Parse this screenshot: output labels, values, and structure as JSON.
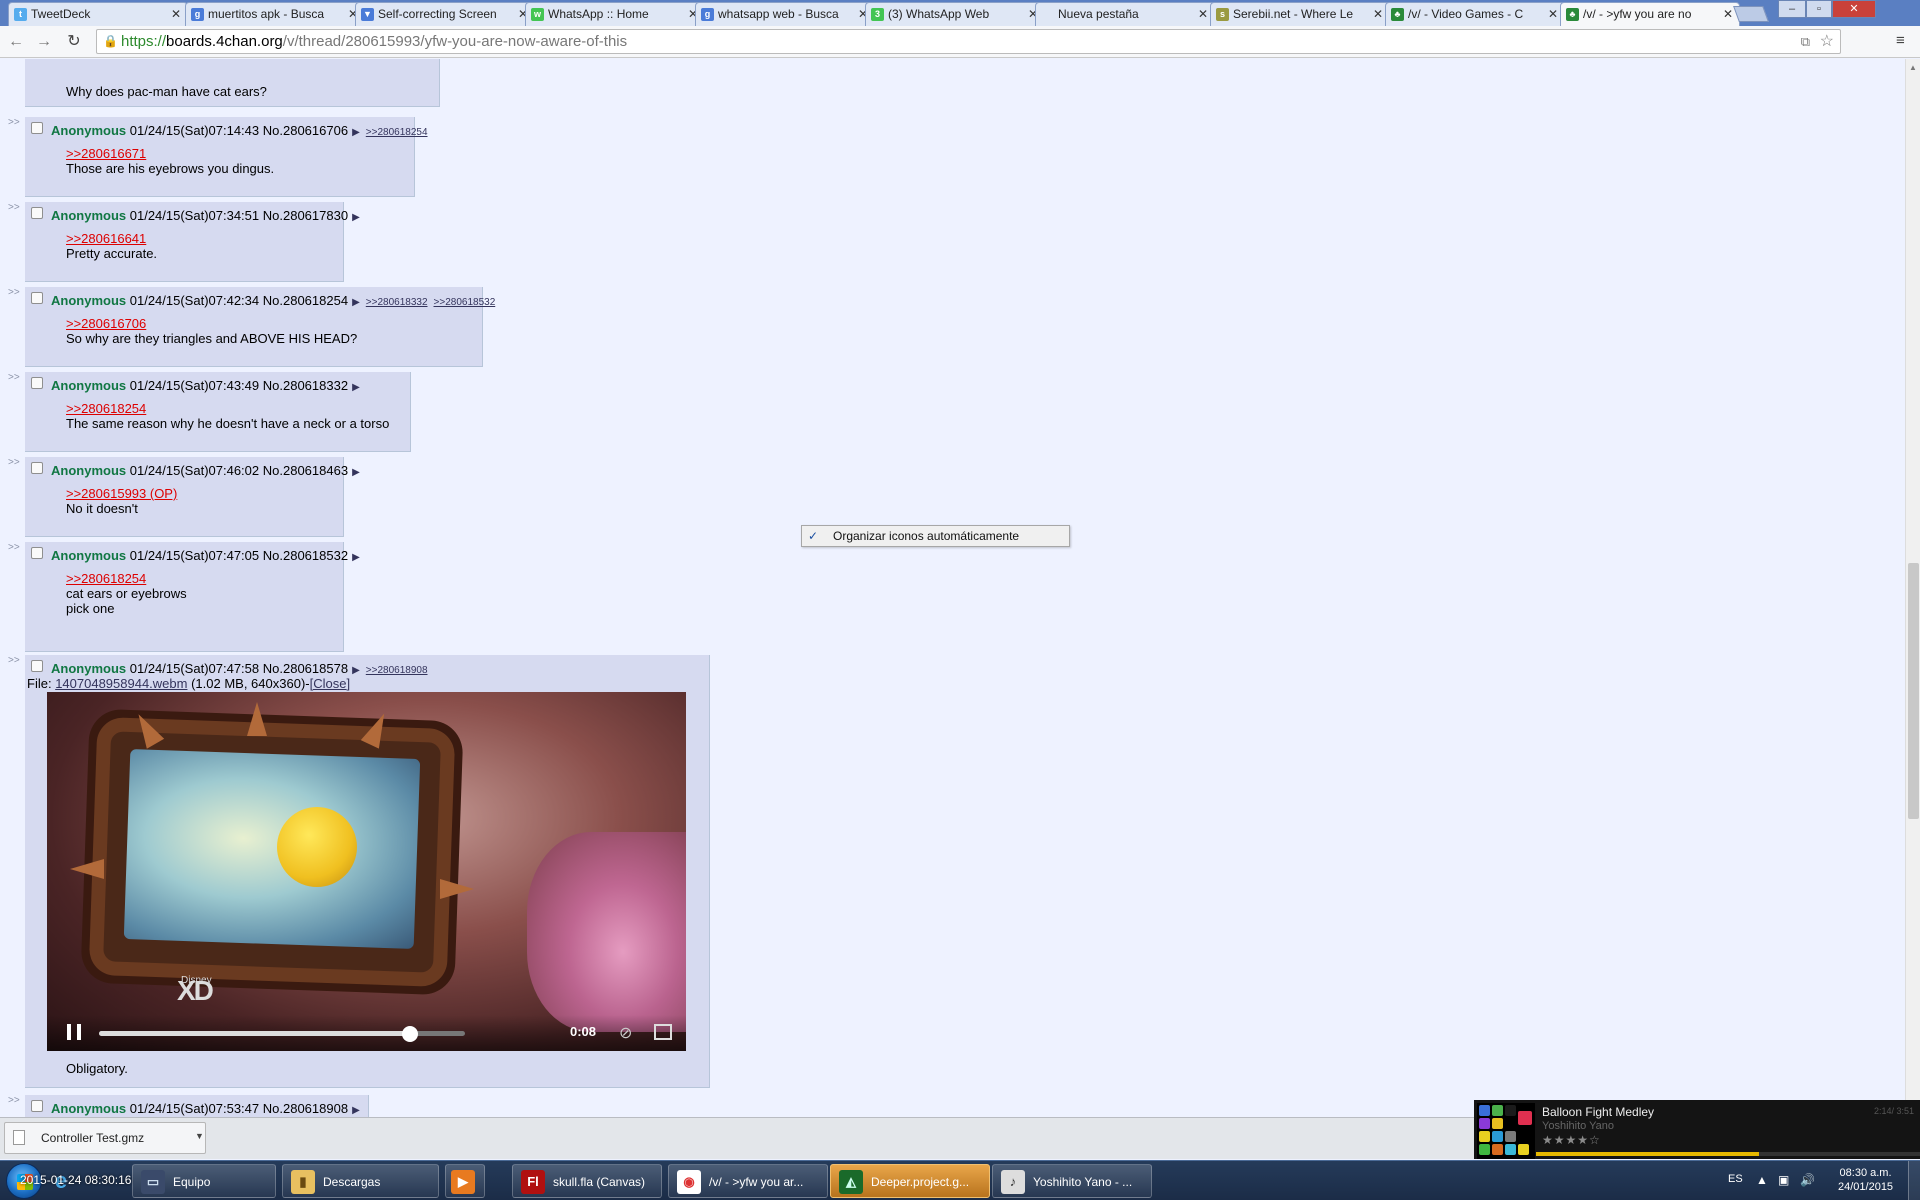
{
  "browser": {
    "tabs": [
      {
        "title": "TweetDeck",
        "favicon": "twitter-icon",
        "color": "#55acee",
        "glyph": "t"
      },
      {
        "title": "muertitos apk - Busca",
        "favicon": "google-icon",
        "color": "#4a7bd8",
        "glyph": "g"
      },
      {
        "title": "Self-correcting Screen",
        "favicon": "bookmark-icon",
        "color": "#4a7bd8",
        "glyph": "▼"
      },
      {
        "title": "WhatsApp :: Home",
        "favicon": "whatsapp-icon",
        "color": "#43c553",
        "glyph": "w"
      },
      {
        "title": "whatsapp web - Busca",
        "favicon": "google-icon",
        "color": "#4a7bd8",
        "glyph": "g"
      },
      {
        "title": "(3) WhatsApp Web",
        "favicon": "whatsapp-icon",
        "color": "#43c553",
        "glyph": "3"
      },
      {
        "title": "Nueva pestaña",
        "favicon": "",
        "color": "transparent",
        "glyph": ""
      },
      {
        "title": "Serebii.net - Where Le",
        "favicon": "serebii-icon",
        "color": "#9a9a40",
        "glyph": "s"
      },
      {
        "title": "/v/ - Video Games - C",
        "favicon": "clover-icon",
        "color": "#2a8a3a",
        "glyph": "♣"
      },
      {
        "title": "/v/ - >yfw you are no",
        "favicon": "clover-icon",
        "color": "#2a8a3a",
        "glyph": "♣",
        "active": true
      }
    ],
    "url": {
      "scheme": "https://",
      "host": "boards.4chan.org",
      "path": "/v/thread/280615993/yfw-you-are-now-aware-of-this"
    }
  },
  "thread": {
    "partial_top_message": "Why does pac-man have cat ears?",
    "posts": [
      {
        "name": "Anonymous",
        "datetime": "01/24/15(Sat)07:14:43",
        "number": "No.280616706",
        "backlinks": [
          ">>280618254"
        ],
        "quote": ">>280616671",
        "lines": [
          "Those are his eyebrows you dingus."
        ]
      },
      {
        "name": "Anonymous",
        "datetime": "01/24/15(Sat)07:34:51",
        "number": "No.280617830",
        "backlinks": [],
        "quote": ">>280616641",
        "lines": [
          "Pretty accurate."
        ]
      },
      {
        "name": "Anonymous",
        "datetime": "01/24/15(Sat)07:42:34",
        "number": "No.280618254",
        "backlinks": [
          ">>280618332",
          ">>280618532"
        ],
        "quote": ">>280616706",
        "lines": [
          "So why are they triangles and ABOVE HIS HEAD?"
        ]
      },
      {
        "name": "Anonymous",
        "datetime": "01/24/15(Sat)07:43:49",
        "number": "No.280618332",
        "backlinks": [],
        "quote": ">>280618254",
        "lines": [
          "The same reason why he doesn't have a neck or a torso"
        ]
      },
      {
        "name": "Anonymous",
        "datetime": "01/24/15(Sat)07:46:02",
        "number": "No.280618463",
        "backlinks": [],
        "quote": ">>280615993 (OP)",
        "lines": [
          "No it doesn't"
        ]
      },
      {
        "name": "Anonymous",
        "datetime": "01/24/15(Sat)07:47:05",
        "number": "No.280618532",
        "backlinks": [],
        "quote": ">>280618254",
        "lines": [
          "cat ears or eyebrows",
          "",
          "pick one"
        ]
      }
    ],
    "video_post": {
      "name": "Anonymous",
      "datetime": "01/24/15(Sat)07:47:58",
      "number": "No.280618578",
      "backlink": ">>280618908",
      "file_label": "File:",
      "file_name": "1407048958944.webm",
      "file_meta": "(1.02 MB, 640x360)-",
      "close_label": "[Close]",
      "video": {
        "time": "0:08",
        "progress": 0.85,
        "watermark": "XD",
        "watermark_small": "Disney"
      },
      "message": "Obligatory."
    },
    "last_post": {
      "name": "Anonymous",
      "datetime": "01/24/15(Sat)07:53:47",
      "number": "No.280618908"
    }
  },
  "context_menu": {
    "check": "✓",
    "label": "Organizar iconos automáticamente"
  },
  "download": {
    "filename": "Controller Test.gmz"
  },
  "music": {
    "title": "Balloon Fight Medley",
    "artist": "Yoshihito Yano",
    "time": "2:14/ 3:51",
    "rating": 4,
    "progress": 0.58
  },
  "taskbar": {
    "overlay_time": "2015-01-24 08:30:16",
    "buttons": [
      {
        "label": "Equipo",
        "icon": "computer-icon"
      },
      {
        "label": "Descargas",
        "icon": "folder-icon"
      },
      {
        "label": "",
        "icon": "media-player-icon"
      },
      {
        "label": "skull.fla (Canvas)",
        "icon": "flash-icon"
      },
      {
        "label": "/v/ - >yfw you ar...",
        "icon": "chrome-icon"
      },
      {
        "label": "Deeper.project.g...",
        "icon": "gamemaker-icon"
      },
      {
        "label": "Yoshihito Yano - ...",
        "icon": "musicbee-icon"
      }
    ],
    "language": "ES",
    "clock_time": "08:30 a.m.",
    "clock_date": "24/01/2015"
  }
}
